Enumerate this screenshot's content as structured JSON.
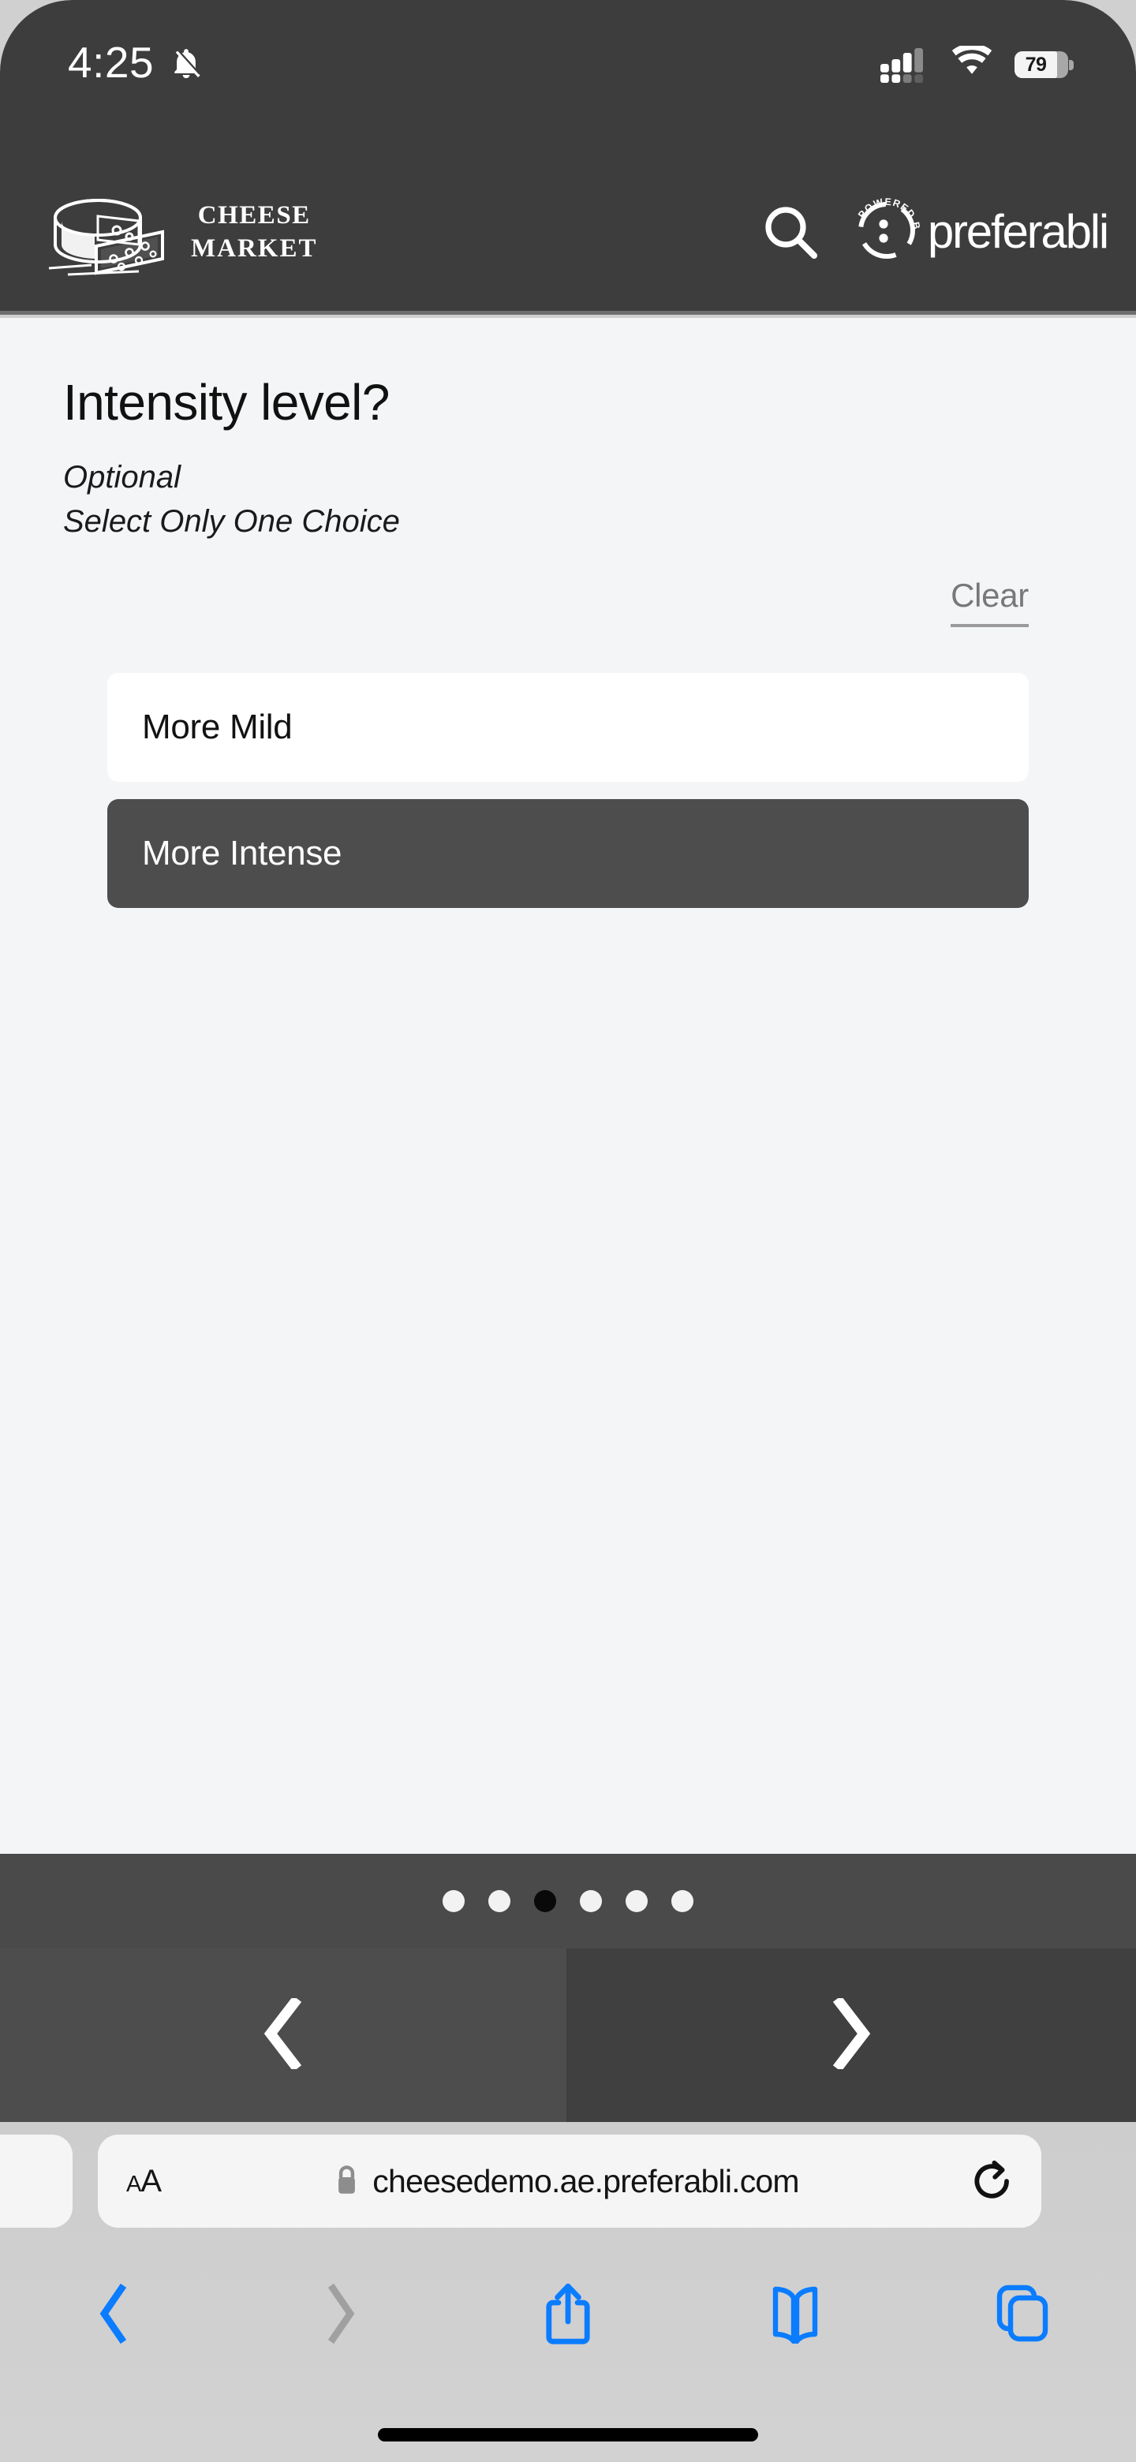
{
  "status_bar": {
    "time": "4:25",
    "silent_icon": "bell-slash-icon",
    "cellular_icon": "cellular-signal-icon",
    "wifi_icon": "wifi-icon",
    "battery_percent": "79",
    "battery_fill_ratio": 0.79
  },
  "site_header": {
    "brand_line1": "CHEESE",
    "brand_line2": "MARKET",
    "logo_icon": "cheese-wheel-logo-icon",
    "search_icon": "search-icon",
    "powered_by_label": "POWERED BY",
    "powered_brand": "preferabli",
    "background_color": "#3d3d3d"
  },
  "question": {
    "title": "Intensity level?",
    "optional_label": "Optional",
    "instruction": "Select Only One Choice",
    "clear_label": "Clear",
    "options": [
      {
        "label": "More Mild",
        "selected": false
      },
      {
        "label": "More Intense",
        "selected": true
      }
    ],
    "selected_color": "#4d4d4d",
    "unselected_color": "#ffffff",
    "background_color": "#f4f5f7"
  },
  "pagination": {
    "total": 6,
    "active_index": 2,
    "prev_icon": "chevron-left-icon",
    "next_icon": "chevron-right-icon",
    "active_dot_color": "#090909",
    "inactive_dot_color": "#f2f2f2"
  },
  "browser": {
    "text_size_label_big": "A",
    "text_size_label_small": "A",
    "lock_icon": "lock-icon",
    "url": "cheesedemo.ae.preferabli.com",
    "reload_icon": "reload-icon",
    "toolbar": [
      {
        "name": "back",
        "icon": "chevron-left-icon",
        "enabled": true
      },
      {
        "name": "forward",
        "icon": "chevron-right-icon",
        "enabled": false
      },
      {
        "name": "share",
        "icon": "share-icon",
        "enabled": true
      },
      {
        "name": "bookmarks",
        "icon": "book-icon",
        "enabled": true
      },
      {
        "name": "tabs",
        "icon": "tabs-icon",
        "enabled": true
      }
    ],
    "accent_color": "#0a7cff",
    "disabled_color": "#a0a0a0"
  }
}
